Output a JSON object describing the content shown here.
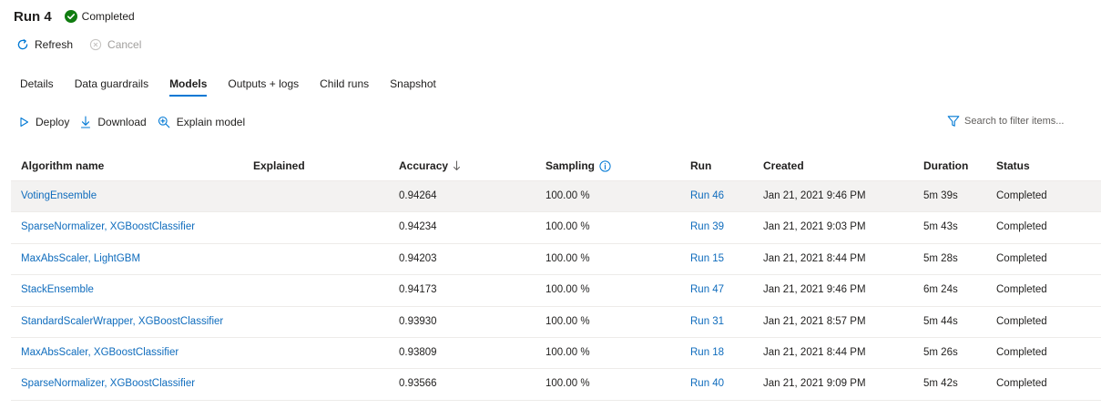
{
  "header": {
    "title": "Run 4",
    "status": "Completed",
    "status_color": "#107c10"
  },
  "actions": {
    "refresh": "Refresh",
    "cancel": "Cancel"
  },
  "tabs": [
    {
      "label": "Details",
      "active": false
    },
    {
      "label": "Data guardrails",
      "active": false
    },
    {
      "label": "Models",
      "active": true
    },
    {
      "label": "Outputs + logs",
      "active": false
    },
    {
      "label": "Child runs",
      "active": false
    },
    {
      "label": "Snapshot",
      "active": false
    }
  ],
  "toolbar": {
    "deploy": "Deploy",
    "download": "Download",
    "explain": "Explain model",
    "filter_placeholder": "Search to filter items..."
  },
  "table": {
    "columns": {
      "algorithm": "Algorithm name",
      "explained": "Explained",
      "accuracy": "Accuracy",
      "sampling": "Sampling",
      "run": "Run",
      "created": "Created",
      "duration": "Duration",
      "status": "Status"
    },
    "rows": [
      {
        "algorithm": "VotingEnsemble",
        "explained": "",
        "accuracy": "0.94264",
        "sampling": "100.00 %",
        "run": "Run 46",
        "created": "Jan 21, 2021 9:46 PM",
        "duration": "5m 39s",
        "status": "Completed"
      },
      {
        "algorithm": "SparseNormalizer, XGBoostClassifier",
        "explained": "",
        "accuracy": "0.94234",
        "sampling": "100.00 %",
        "run": "Run 39",
        "created": "Jan 21, 2021 9:03 PM",
        "duration": "5m 43s",
        "status": "Completed"
      },
      {
        "algorithm": "MaxAbsScaler, LightGBM",
        "explained": "",
        "accuracy": "0.94203",
        "sampling": "100.00 %",
        "run": "Run 15",
        "created": "Jan 21, 2021 8:44 PM",
        "duration": "5m 28s",
        "status": "Completed"
      },
      {
        "algorithm": "StackEnsemble",
        "explained": "",
        "accuracy": "0.94173",
        "sampling": "100.00 %",
        "run": "Run 47",
        "created": "Jan 21, 2021 9:46 PM",
        "duration": "6m 24s",
        "status": "Completed"
      },
      {
        "algorithm": "StandardScalerWrapper, XGBoostClassifier",
        "explained": "",
        "accuracy": "0.93930",
        "sampling": "100.00 %",
        "run": "Run 31",
        "created": "Jan 21, 2021 8:57 PM",
        "duration": "5m 44s",
        "status": "Completed"
      },
      {
        "algorithm": "MaxAbsScaler, XGBoostClassifier",
        "explained": "",
        "accuracy": "0.93809",
        "sampling": "100.00 %",
        "run": "Run 18",
        "created": "Jan 21, 2021 8:44 PM",
        "duration": "5m 26s",
        "status": "Completed"
      },
      {
        "algorithm": "SparseNormalizer, XGBoostClassifier",
        "explained": "",
        "accuracy": "0.93566",
        "sampling": "100.00 %",
        "run": "Run 40",
        "created": "Jan 21, 2021 9:09 PM",
        "duration": "5m 42s",
        "status": "Completed"
      }
    ]
  },
  "colors": {
    "accent": "#0078d4",
    "link": "#0f6cbd",
    "selected_row": "#f3f2f1"
  },
  "icons": {
    "status": "check-circle-icon",
    "refresh": "refresh-icon",
    "cancel": "cancel-icon",
    "deploy": "play-icon",
    "download": "download-icon",
    "explain": "zoom-in-icon",
    "filter": "filter-icon",
    "sort": "arrow-down-icon",
    "info": "info-icon"
  }
}
